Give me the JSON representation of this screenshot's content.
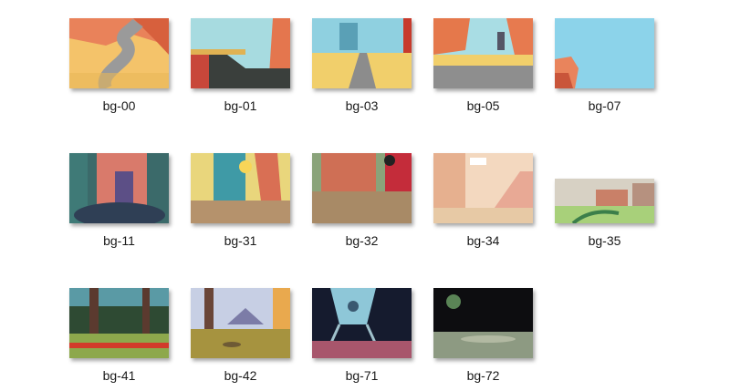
{
  "window": {
    "view": "large-icons"
  },
  "files": [
    {
      "name": "bg-00",
      "icon": "image-thumbnail"
    },
    {
      "name": "bg-01",
      "icon": "image-thumbnail"
    },
    {
      "name": "bg-03",
      "icon": "image-thumbnail"
    },
    {
      "name": "bg-05",
      "icon": "image-thumbnail"
    },
    {
      "name": "bg-07",
      "icon": "image-thumbnail"
    },
    {
      "name": "bg-11",
      "icon": "image-thumbnail"
    },
    {
      "name": "bg-31",
      "icon": "image-thumbnail"
    },
    {
      "name": "bg-32",
      "icon": "image-thumbnail"
    },
    {
      "name": "bg-34",
      "icon": "image-thumbnail"
    },
    {
      "name": "bg-35",
      "icon": "image-thumbnail"
    },
    {
      "name": "bg-41",
      "icon": "image-thumbnail"
    },
    {
      "name": "bg-42",
      "icon": "image-thumbnail"
    },
    {
      "name": "bg-71",
      "icon": "image-thumbnail"
    },
    {
      "name": "bg-72",
      "icon": "image-thumbnail"
    }
  ]
}
